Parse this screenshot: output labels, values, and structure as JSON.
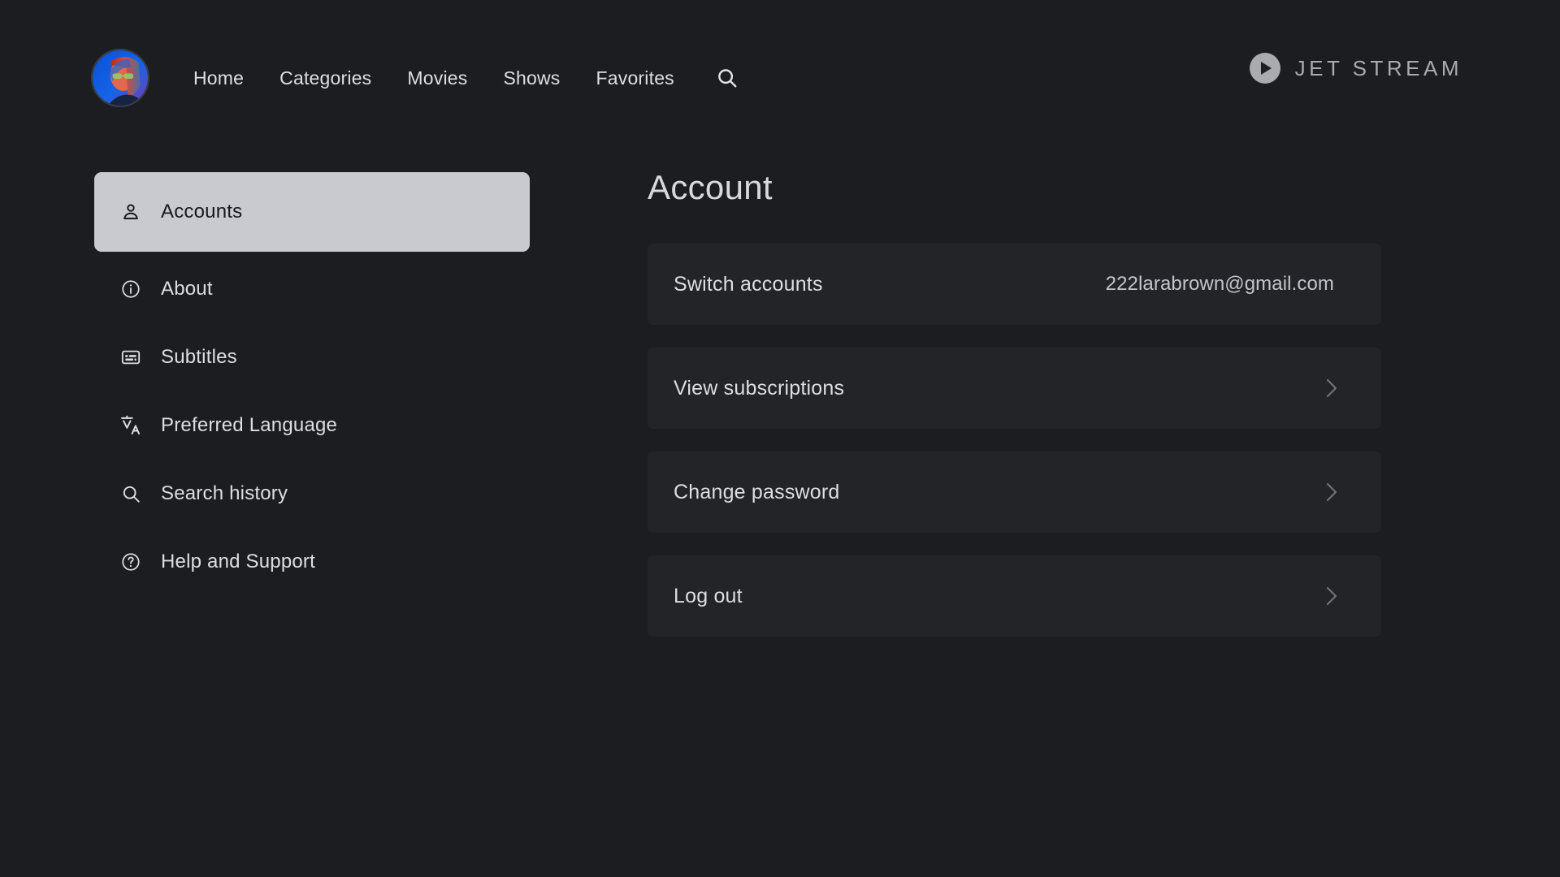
{
  "nav": {
    "avatar_alt": "user-avatar",
    "links": [
      {
        "label": "Home"
      },
      {
        "label": "Categories"
      },
      {
        "label": "Movies"
      },
      {
        "label": "Shows"
      },
      {
        "label": "Favorites"
      }
    ],
    "search_icon": "search-icon",
    "brand": {
      "name": "JET STREAM",
      "mark_icon": "play-circle-icon"
    }
  },
  "sidebar": {
    "items": [
      {
        "label": "Accounts",
        "icon": "person-icon",
        "active": true
      },
      {
        "label": "About",
        "icon": "info-circle-icon",
        "active": false
      },
      {
        "label": "Subtitles",
        "icon": "closed-caption-icon",
        "active": false
      },
      {
        "label": "Preferred Language",
        "icon": "translate-icon",
        "active": false
      },
      {
        "label": "Search history",
        "icon": "search-icon",
        "active": false
      },
      {
        "label": "Help and Support",
        "icon": "question-circle-icon",
        "active": false
      }
    ]
  },
  "main": {
    "title": "Account",
    "rows": [
      {
        "label": "Switch accounts",
        "value": "222larabrown@gmail.com",
        "chevron": false
      },
      {
        "label": "View subscriptions",
        "value": "",
        "chevron": true
      },
      {
        "label": "Change password",
        "value": "",
        "chevron": true
      },
      {
        "label": "Log out",
        "value": "",
        "chevron": true
      }
    ]
  },
  "colors": {
    "background": "#1c1d20",
    "card": "#232428",
    "active_item": "#c9cacf",
    "text_primary": "#dcdee2",
    "text_muted": "#a9abaf"
  }
}
